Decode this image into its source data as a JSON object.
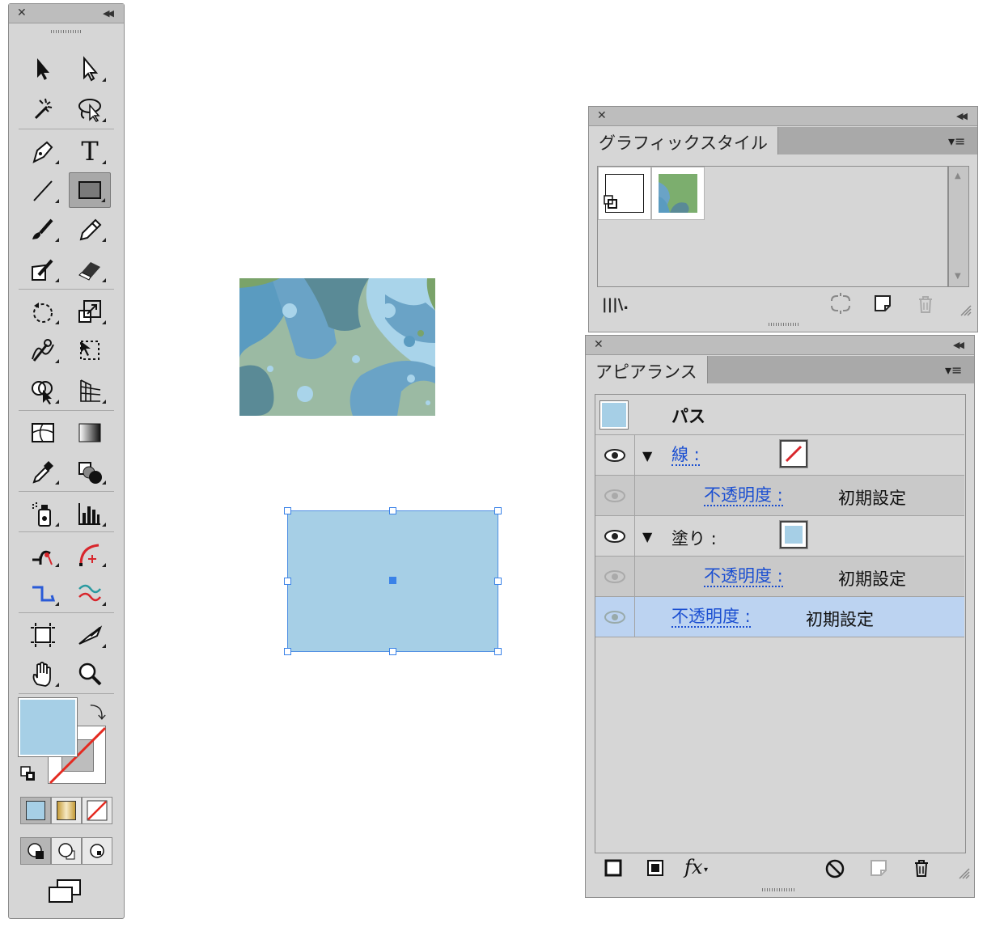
{
  "tools_panel": {
    "close_glyph": "✕",
    "collapse_glyph": "◀◀",
    "tools": [
      "selection-tool",
      "direct-selection-tool",
      "magic-wand-tool",
      "lasso-tool",
      "pen-tool",
      "type-tool",
      "line-segment-tool",
      "rectangle-tool",
      "paintbrush-tool",
      "pencil-tool",
      "blob-brush-tool",
      "eraser-tool",
      "rotate-tool",
      "scale-tool",
      "warp-tool",
      "free-transform-tool",
      "shape-builder-tool",
      "perspective-grid-tool",
      "mesh-tool",
      "gradient-tool",
      "eyedropper-tool",
      "blend-tool",
      "symbol-sprayer-tool",
      "column-graph-tool",
      "artboard-tool",
      "slice-tool",
      "hand-tool",
      "zoom-tool"
    ],
    "type_tool_glyph": "T",
    "fill_color": "#a6cfe6",
    "stroke_color": "none"
  },
  "graphic_styles": {
    "close_glyph": "✕",
    "collapse_glyph": "◀◀",
    "tab_label": "グラフィックスタイル",
    "menu_glyph": "▾≡",
    "library_glyph": "|||\\.",
    "styles": [
      "default-style",
      "pattern-style"
    ]
  },
  "appearance": {
    "close_glyph": "✕",
    "collapse_glyph": "◀◀",
    "tab_label": "アピアランス",
    "menu_glyph": "▾≡",
    "object_label": "パス",
    "rows": [
      {
        "kind": "stroke",
        "label": "線 :",
        "swatch": "none"
      },
      {
        "kind": "opacity",
        "label": "不透明度 :",
        "value": "初期設定"
      },
      {
        "kind": "fill",
        "label": "塗り :",
        "swatch": "#a6cfe6"
      },
      {
        "kind": "opacity",
        "label": "不透明度 :",
        "value": "初期設定"
      },
      {
        "kind": "opacity-object",
        "label": "不透明度 :",
        "value": "初期設定"
      }
    ],
    "fx_label": "fx"
  },
  "colors": {
    "accent_blue": "#3a82e8",
    "link_blue": "#1b4fd1",
    "panel_gray": "#d6d6d6",
    "highlight_row": "#bcd3f1",
    "fill_blue": "#a6cfe6"
  }
}
